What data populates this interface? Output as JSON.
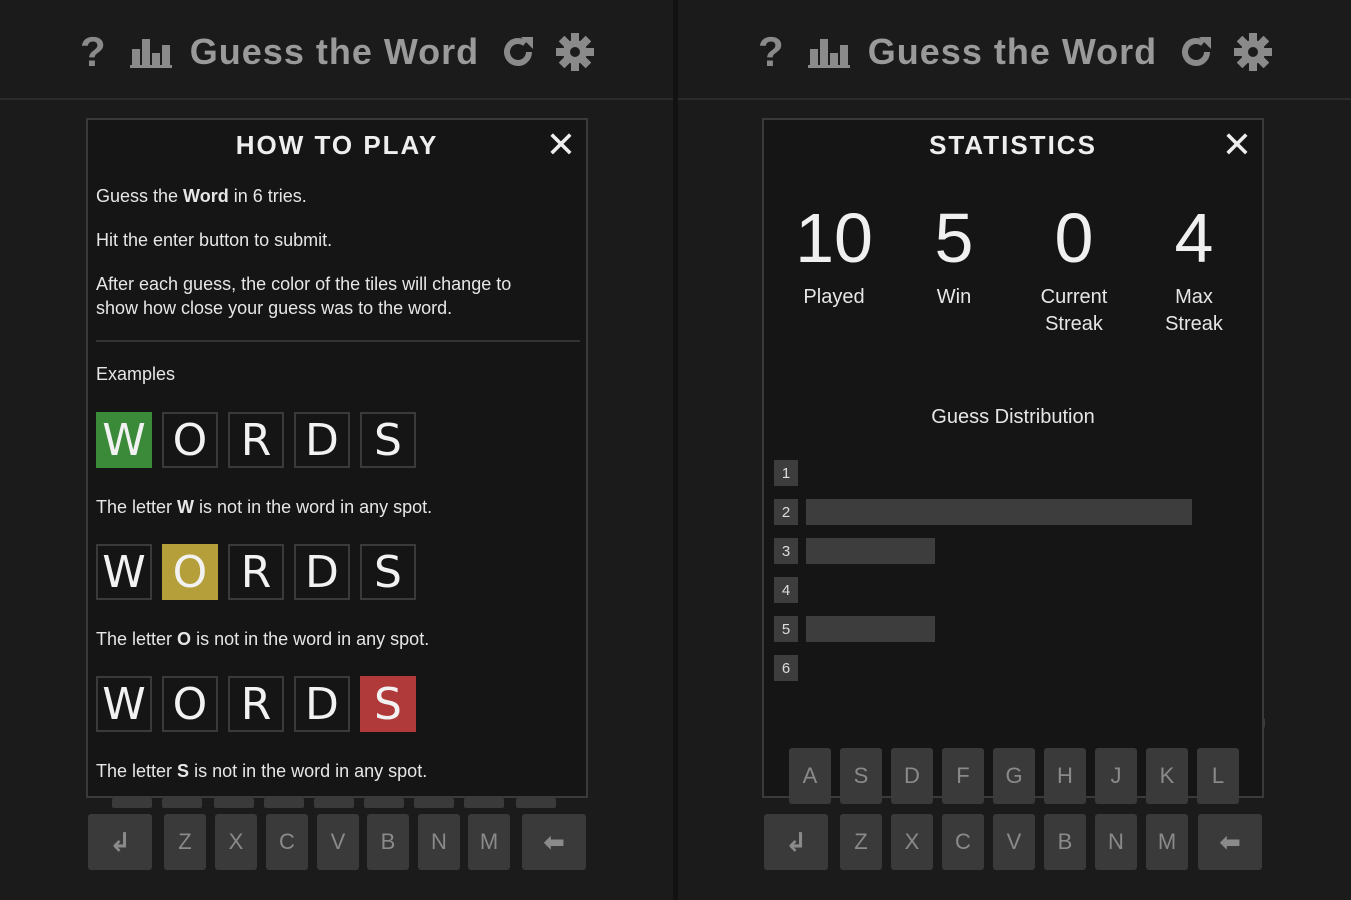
{
  "app_title": "Guess the Word",
  "icons": {
    "help": "?",
    "refresh": "↻",
    "stats": "bar-chart",
    "settings": "gear"
  },
  "colors": {
    "correct": "#3a8a3a",
    "present": "#b59f3b",
    "absent": "#b03a3a",
    "tile_border": "#3a3a3a",
    "key_bg": "#3a3a3a"
  },
  "help_modal": {
    "title": "HOW TO PLAY",
    "close": "✕",
    "intro": {
      "pre": "Guess the ",
      "bold": "Word",
      "post": " in 6 tries."
    },
    "line2": "Hit the enter button to submit.",
    "line3a": "After each guess, the color of the tiles will change to",
    "line3b": "show how close your guess was to the word.",
    "examples_label": "Examples",
    "examples": [
      {
        "letters": [
          "W",
          "O",
          "R",
          "D",
          "S"
        ],
        "highlight": 0,
        "color": "correct",
        "desc_pre": "The letter ",
        "desc_letter": "W",
        "desc_post": " is not in the word in any spot."
      },
      {
        "letters": [
          "W",
          "O",
          "R",
          "D",
          "S"
        ],
        "highlight": 1,
        "color": "present",
        "desc_pre": "The letter ",
        "desc_letter": "O",
        "desc_post": " is not in the word in any spot."
      },
      {
        "letters": [
          "W",
          "O",
          "R",
          "D",
          "S"
        ],
        "highlight": 4,
        "color": "absent",
        "desc_pre": "The letter ",
        "desc_letter": "S",
        "desc_post": " is not in the word in any spot."
      }
    ]
  },
  "stats_modal": {
    "title": "STATISTICS",
    "close": "✕",
    "stats": [
      {
        "value": "10",
        "label1": "Played",
        "label2": ""
      },
      {
        "value": "5",
        "label1": "Win",
        "label2": ""
      },
      {
        "value": "0",
        "label1": "Current",
        "label2": "Streak"
      },
      {
        "value": "4",
        "label1": "Max",
        "label2": "Streak"
      }
    ],
    "distribution_title": "Guess Distribution",
    "distribution": [
      {
        "guess": "1",
        "count": 0
      },
      {
        "guess": "2",
        "count": 3
      },
      {
        "guess": "3",
        "count": 1
      },
      {
        "guess": "4",
        "count": 0
      },
      {
        "guess": "5",
        "count": 1
      },
      {
        "guess": "6",
        "count": 0
      }
    ]
  },
  "keyboard": {
    "row2": [
      "A",
      "S",
      "D",
      "F",
      "G",
      "H",
      "J",
      "K",
      "L"
    ],
    "row3": [
      "Z",
      "X",
      "C",
      "V",
      "B",
      "N",
      "M"
    ],
    "enter": "↲",
    "backspace": "⬅"
  }
}
